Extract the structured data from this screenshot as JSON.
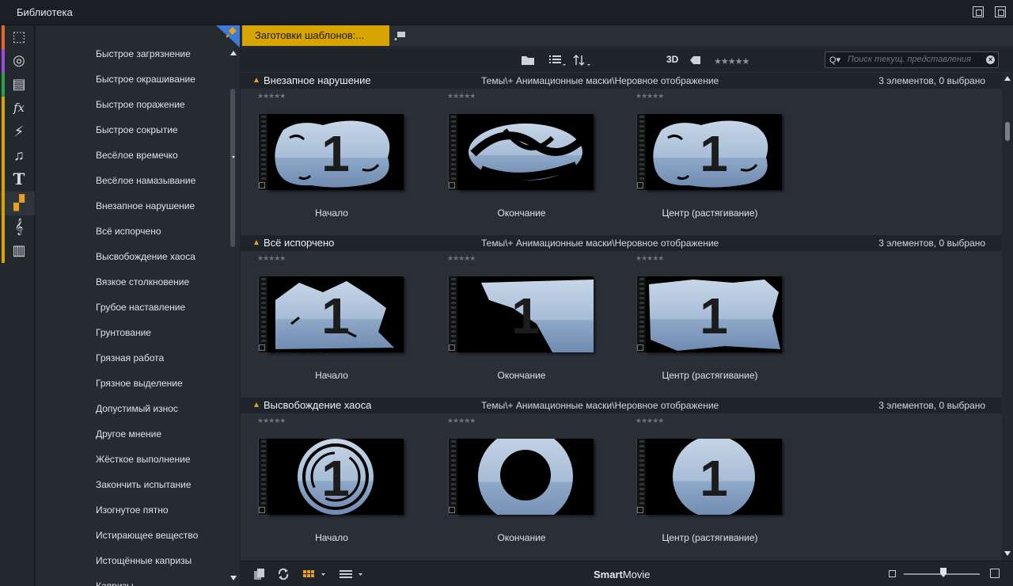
{
  "window": {
    "title": "Библиотека"
  },
  "sidebar_icons": [
    {
      "name": "project-bin-icon",
      "glyph": "⬚",
      "color": "#e5672c"
    },
    {
      "name": "film-reel-icon",
      "glyph": "◎",
      "color": "#9b4fd8"
    },
    {
      "name": "photos-icon",
      "glyph": "▤",
      "color": "#2f9e4a"
    },
    {
      "name": "effects-icon",
      "glyph": "fx",
      "color": "#d7a400"
    },
    {
      "name": "transitions-icon",
      "glyph": "⚡",
      "color": "#d7a400"
    },
    {
      "name": "music-icon",
      "glyph": "♫",
      "color": "#d7a400"
    },
    {
      "name": "titles-icon",
      "glyph": "T",
      "color": "#d7a400"
    },
    {
      "name": "montage-templates-icon",
      "glyph": "▞",
      "color": "#d7a400",
      "active": true
    },
    {
      "name": "scorefitter-icon",
      "glyph": "𝄞",
      "color": "#d7a400"
    },
    {
      "name": "sound-effects-icon",
      "glyph": "▥",
      "color": "#d7a400"
    }
  ],
  "categories": [
    "Быстрое загрязнение",
    "Быстрое окрашивание",
    "Быстрое поражение",
    "Быстрое сокрытие",
    "Весёлое времечко",
    "Весёлое намазывание",
    "Внезапное нарушение",
    "Всё испорчено",
    "Высвобождение хаоса",
    "Вязкое столкновение",
    "Грубое наставление",
    "Грунтование",
    "Грязная работа",
    "Грязное выделение",
    "Допустимый износ",
    "Другое мнение",
    "Жёсткое выполнение",
    "Закончить испытание",
    "Изогнутое пятно",
    "Истирающее вещество",
    "Истощённые капризы",
    "Капризы"
  ],
  "tab": {
    "label": "Заготовки шаблонов:..."
  },
  "toolbar": {
    "three_d": "3D",
    "stars": "★★★★★",
    "search_placeholder": "Поиск текущ. представления"
  },
  "groups": [
    {
      "name": "Внезапное нарушение",
      "path": "Темы\\+ Анимационные маски\\Неровное отображение",
      "count": "3 элементов, 0 выбрано",
      "clips": [
        {
          "label": "Начало",
          "style": "splash",
          "stars": "★★★★★"
        },
        {
          "label": "Окончание",
          "style": "swirl",
          "stars": "★★★★★"
        },
        {
          "label": "Центр (растягивание)",
          "style": "splash",
          "stars": "★★★★★"
        }
      ]
    },
    {
      "name": "Всё испорчено",
      "path": "Темы\\+ Анимационные маски\\Неровное отображение",
      "count": "3 элементов, 0 выбрано",
      "clips": [
        {
          "label": "Начало",
          "style": "tear-left",
          "stars": "★★★★★"
        },
        {
          "label": "Окончание",
          "style": "tear-right",
          "stars": "★★★★★"
        },
        {
          "label": "Центр (растягивание)",
          "style": "tear-full",
          "stars": "★★★★★"
        }
      ]
    },
    {
      "name": "Высвобождение хаоса",
      "path": "Темы\\+ Анимационные маски\\Неровное отображение",
      "count": "3 элементов, 0 выбрано",
      "clips": [
        {
          "label": "Начало",
          "style": "rings",
          "stars": "★★★★★"
        },
        {
          "label": "Окончание",
          "style": "hole",
          "stars": "★★★★★"
        },
        {
          "label": "Центр (растягивание)",
          "style": "circle",
          "stars": "★★★★★"
        }
      ]
    }
  ],
  "bottombar": {
    "brand_bold": "Smart",
    "brand_rest": "Movie"
  },
  "colors": {
    "accent": "#d7a400",
    "orange": "#e8a020",
    "bg": "#2a2f37",
    "header": "#1f232a"
  }
}
